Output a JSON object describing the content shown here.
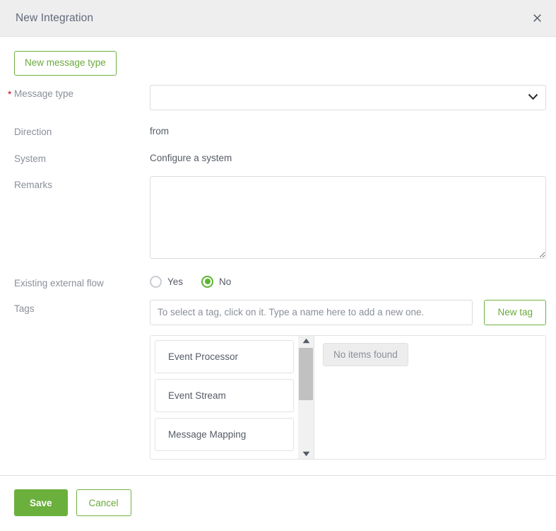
{
  "dialog": {
    "title": "New Integration",
    "close_icon": "close-icon"
  },
  "form": {
    "new_message_type_button": "New message type",
    "message_type": {
      "label": "Message type",
      "required_marker": "*",
      "value": "",
      "placeholder": "",
      "chevron_icon": "chevron-down-icon",
      "options": [
        ""
      ]
    },
    "direction": {
      "label": "Direction",
      "value": "from"
    },
    "system": {
      "label": "System",
      "value": "Configure a system"
    },
    "remarks": {
      "label": "Remarks",
      "value": "",
      "placeholder": ""
    },
    "existing_external_flow": {
      "label": "Existing external flow",
      "selected": "No",
      "options": [
        {
          "label": "Yes",
          "checked": false
        },
        {
          "label": "No",
          "checked": true
        }
      ]
    },
    "tags": {
      "label": "Tags",
      "input_value": "",
      "input_placeholder": "To select a tag, click on it. Type a name here to add a new one.",
      "new_tag_button": "New tag",
      "available_tags": [
        "Event Processor",
        "Event Stream",
        "Message Mapping"
      ],
      "scrollbar": {
        "up_icon": "scroll-up-arrow-icon",
        "down_icon": "scroll-down-arrow-icon"
      },
      "selected_panel_empty_text": "No items found"
    }
  },
  "footer": {
    "save_label": "Save",
    "cancel_label": "Cancel"
  },
  "colors": {
    "accent_green": "#6bb03c",
    "outline_green": "#6fb142",
    "required_red": "#d0021b",
    "header_bg": "#eeeeee",
    "label_grey": "#8a8f99"
  }
}
